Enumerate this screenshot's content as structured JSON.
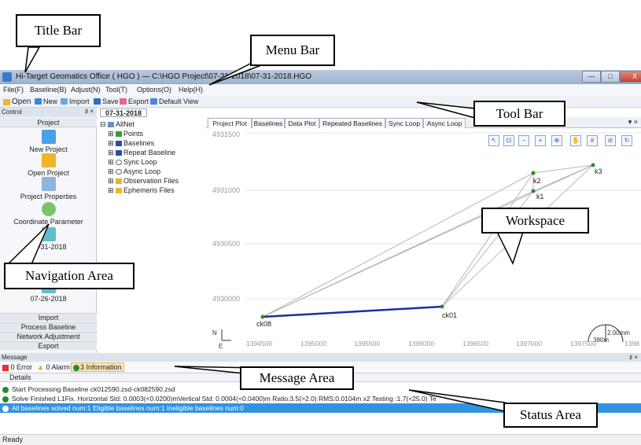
{
  "callouts": {
    "title_bar": "Title Bar",
    "menu_bar": "Menu Bar",
    "tool_bar": "Tool Bar",
    "workspace": "Workspace",
    "navigation_area": "Navigation Area",
    "message_area": "Message Area",
    "status_area": "Status Area"
  },
  "window": {
    "title": "Hi-Target Geomatics Office ( HGO ) — C:\\HGO Project\\07-31-2018\\07-31-2018.HGO",
    "buttons": [
      "—",
      "□",
      "X"
    ]
  },
  "menu": [
    "File(F)",
    "Baseline(B)",
    "Adjust(N)",
    "Tool(T)",
    "Options(O)",
    "Help(H)"
  ],
  "toolbar": {
    "open": "Open",
    "new": "New",
    "import": "Import",
    "save": "Save",
    "export": "Export",
    "default_view": "Default View",
    "colors": {
      "folder": "#f0b429",
      "doc": "#3a88d8",
      "save": "#2f6fb3"
    }
  },
  "control": {
    "header": "Control",
    "header_pin": "♯ ×",
    "section": "Project",
    "items": [
      "New Project",
      "Open Project",
      "Project Properties",
      "Coordinate Parameter",
      "07-31-2018",
      "07-26-2018"
    ],
    "bottom_sections": [
      "Import",
      "Process Baseline",
      "Network Adjustment",
      "Export"
    ]
  },
  "tree": {
    "date_tab": "07-31-2018",
    "root": "AllNet",
    "children": [
      "Points",
      "Baselines",
      "Repeat Baseline",
      "Sync Loop",
      "Async Loop",
      "Observation Files",
      "Ephemeris Files"
    ]
  },
  "plot": {
    "tabs": [
      "Project Plot",
      "Baselines",
      "Data Plot",
      "Repeated Baselines",
      "Sync Loop",
      "Async Loop"
    ],
    "active_tab": "Project Plot",
    "panel_controls": "▾ ×",
    "y_ticks": [
      "4931500",
      "4931000",
      "4930500",
      "4930000"
    ],
    "x_ticks": [
      "1394500",
      "1395000",
      "1395500",
      "1396000",
      "1396500",
      "1397000",
      "1397500",
      "1398"
    ],
    "points": [
      "ck08",
      "ck01",
      "k1",
      "k2",
      "k3"
    ],
    "north_label": "N",
    "east_label": "E",
    "scale_label": "2.00mm",
    "scale_sub": "380m",
    "colors": {
      "baseline": "#1a2fa0",
      "net": "#b8b8b8",
      "point": "#2a8a2a"
    }
  },
  "message": {
    "header": "Message",
    "header_pin": "♯ ×",
    "error": "0 Error",
    "alarm": "0 Alarm",
    "info": "3 Information",
    "details_col": "Details",
    "rows": [
      "Start Processing Baseline   ck012590.zsd-ck082590.zsd",
      "Solve Finished  L1Fix. Horizontal Std: 0.0003(<0.0200)mVertical Std: 0.0004(<0.0400)m Ratio:3.5(>2.0) RMS:0.0104m x2 Testing :1.7(<25.0)  Te",
      "All baselines solved num:1   Eligible baselines num:1   Ineligible baselines num:0"
    ]
  },
  "status": {
    "text": "Ready"
  }
}
